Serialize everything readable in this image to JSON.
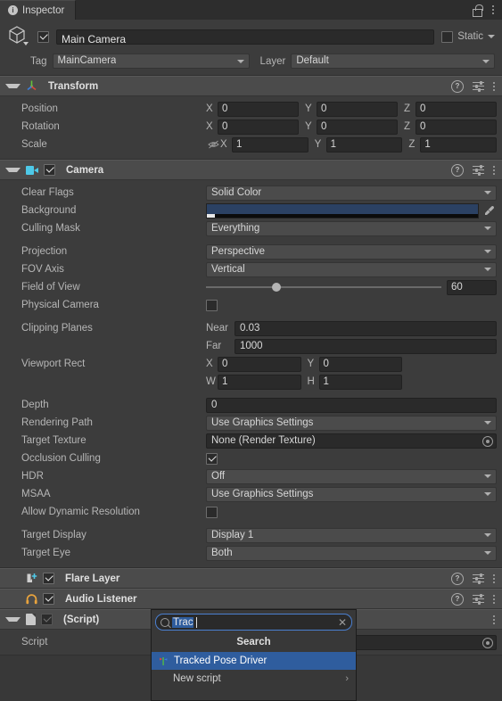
{
  "window": {
    "tab_label": "Inspector",
    "tab_icon": "info-icon",
    "lock_icon": "lock-open-icon",
    "menu_icon": "kebab-menu-icon"
  },
  "object_header": {
    "icon": "gameobject-cube-icon",
    "enabled": true,
    "name": "Main Camera",
    "static_label": "Static",
    "static_checked": false,
    "tag_label": "Tag",
    "tag_value": "MainCamera",
    "layer_label": "Layer",
    "layer_value": "Default"
  },
  "components": [
    {
      "id": "transform",
      "title": "Transform",
      "icon": "transform-axis-icon",
      "has_checkbox": false,
      "expanded": true,
      "header_icons": [
        "help-icon",
        "preset-icon",
        "kebab-menu-icon"
      ],
      "rows": [
        {
          "type": "vector3",
          "name": "Position",
          "axes": [
            "X",
            "Y",
            "Z"
          ],
          "values": [
            "0",
            "0",
            "0"
          ]
        },
        {
          "type": "vector3",
          "name": "Rotation",
          "axes": [
            "X",
            "Y",
            "Z"
          ],
          "values": [
            "0",
            "0",
            "0"
          ]
        },
        {
          "type": "vector3",
          "name": "Scale",
          "axes": [
            "X",
            "Y",
            "Z"
          ],
          "values": [
            "1",
            "1",
            "1"
          ],
          "prefix_icon": "eye-off-icon"
        }
      ]
    },
    {
      "id": "camera",
      "title": "Camera",
      "icon": "camera-icon",
      "has_checkbox": true,
      "enabled": true,
      "expanded": true,
      "header_icons": [
        "help-icon",
        "preset-icon",
        "kebab-menu-icon"
      ],
      "rows": [
        {
          "type": "dropdown",
          "name": "Clear Flags",
          "value": "Solid Color"
        },
        {
          "type": "color",
          "name": "Background",
          "color": "#2b4163",
          "alpha_hex": "#0b0b0b",
          "eyedropper": true
        },
        {
          "type": "dropdown",
          "name": "Culling Mask",
          "value": "Everything"
        },
        {
          "type": "gap"
        },
        {
          "type": "dropdown",
          "name": "Projection",
          "value": "Perspective"
        },
        {
          "type": "dropdown",
          "name": "FOV Axis",
          "value": "Vertical"
        },
        {
          "type": "slider",
          "name": "Field of View",
          "value": "60",
          "slider_pct": 30
        },
        {
          "type": "checkbox",
          "name": "Physical Camera",
          "checked": false
        },
        {
          "type": "gap"
        },
        {
          "type": "labeled_field",
          "name": "Clipping Planes",
          "sub_label": "Near",
          "value": "0.03"
        },
        {
          "type": "labeled_field",
          "name": "",
          "sub_label": "Far",
          "value": "1000"
        },
        {
          "type": "vector2",
          "name": "Viewport Rect",
          "axes": [
            "X",
            "Y"
          ],
          "values": [
            "0",
            "0"
          ]
        },
        {
          "type": "vector2",
          "name": "",
          "axes": [
            "W",
            "H"
          ],
          "values": [
            "1",
            "1"
          ]
        },
        {
          "type": "gap"
        },
        {
          "type": "field",
          "name": "Depth",
          "value": "0"
        },
        {
          "type": "dropdown",
          "name": "Rendering Path",
          "value": "Use Graphics Settings"
        },
        {
          "type": "object",
          "name": "Target Texture",
          "value": "None (Render Texture)"
        },
        {
          "type": "checkbox",
          "name": "Occlusion Culling",
          "checked": true
        },
        {
          "type": "dropdown",
          "name": "HDR",
          "value": "Off"
        },
        {
          "type": "dropdown",
          "name": "MSAA",
          "value": "Use Graphics Settings"
        },
        {
          "type": "checkbox",
          "name": "Allow Dynamic Resolution",
          "checked": false
        },
        {
          "type": "gap"
        },
        {
          "type": "dropdown",
          "name": "Target Display",
          "value": "Display 1"
        },
        {
          "type": "dropdown",
          "name": "Target Eye",
          "value": "Both"
        }
      ]
    },
    {
      "id": "flare-layer",
      "title": "Flare Layer",
      "icon": "flare-layer-icon",
      "has_checkbox": true,
      "enabled": true,
      "expanded": false,
      "header_icons": [
        "help-icon",
        "preset-icon",
        "kebab-menu-icon"
      ],
      "rows": []
    },
    {
      "id": "audio-listener",
      "title": "Audio Listener",
      "icon": "audio-listener-icon",
      "has_checkbox": true,
      "enabled": true,
      "expanded": false,
      "header_icons": [
        "help-icon",
        "preset-icon",
        "kebab-menu-icon"
      ],
      "rows": []
    },
    {
      "id": "script",
      "title": "(Script)",
      "icon": "script-file-icon",
      "has_checkbox": true,
      "enabled": true,
      "dim_checkbox": true,
      "expanded": true,
      "header_icons": [
        "kebab-menu-icon"
      ],
      "rows": [
        {
          "type": "object",
          "name": "Script",
          "value": ""
        }
      ]
    }
  ],
  "popup": {
    "search_value": "Trac",
    "search_selected": true,
    "search_icon": "magnifier-icon",
    "clear_icon": "clear-x-icon",
    "title": "Search",
    "items": [
      {
        "label": "Tracked Pose Driver",
        "selected": true,
        "icon": "tracked-pose-driver-icon",
        "submenu": false
      },
      {
        "label": "New script",
        "selected": false,
        "icon": null,
        "submenu": true,
        "submenu_icon": "chevron-right-icon"
      }
    ]
  },
  "colors": {
    "accent_blue": "#2f5d9e",
    "camera_cyan": "#4ec9e8",
    "audio_orange": "#e8a33d",
    "panel_bg": "#383838",
    "header_bg": "#4b4b4b",
    "body_bg": "#3c3c3c"
  }
}
